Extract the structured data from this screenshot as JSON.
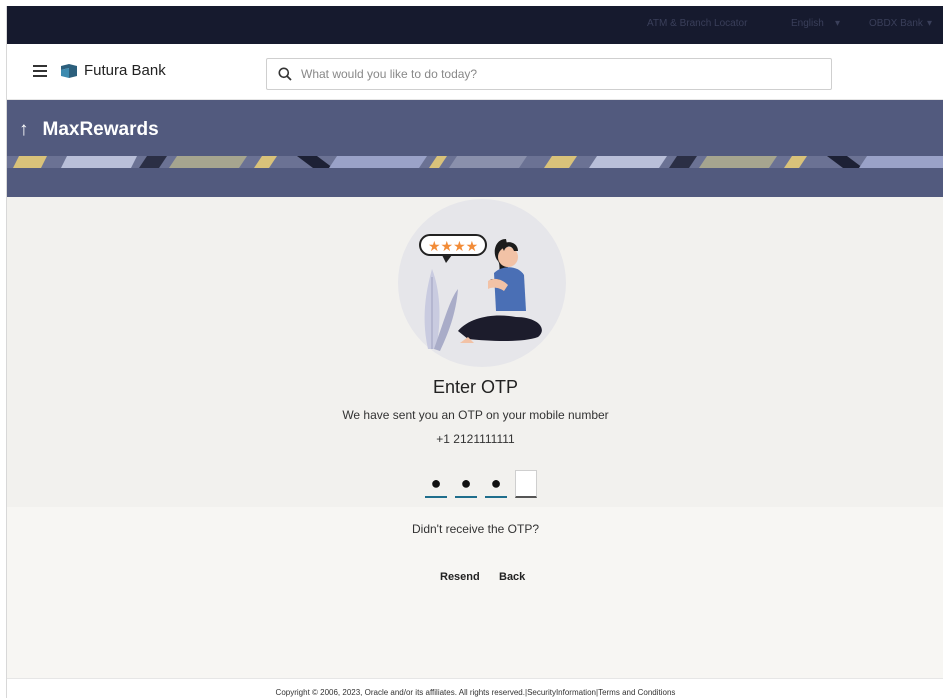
{
  "topbar": {
    "items": [
      "ATM & Branch Locator",
      "English",
      "OBDX Bank"
    ]
  },
  "header": {
    "brand_name": "Futura Bank",
    "search_placeholder": "What would you like to do today?"
  },
  "banner": {
    "title": "MaxRewards"
  },
  "otp": {
    "title": "Enter OTP",
    "subtitle": "We have sent you an OTP on your mobile number",
    "phone": "+1 2121111111",
    "digits": [
      "●",
      "●",
      "●",
      ""
    ],
    "didnt_receive": "Didn't receive the OTP?",
    "resend_label": "Resend",
    "back_label": "Back"
  },
  "footer": {
    "copyright": "Copyright © 2006, 2023, Oracle and/or its affiliates. All rights reserved.",
    "separator": "|",
    "security_link": "SecurityInformation",
    "terms_link": "Terms and Conditions"
  },
  "colors": {
    "topbar": "#161a2e",
    "banner": "#525a7e",
    "brand_logo": "#2c5f7c",
    "otp_underline": "#1f6e8c"
  },
  "icons": [
    "hamburger-icon",
    "brand-logo-icon",
    "search-icon",
    "up-arrow-icon",
    "dropdown-icon"
  ]
}
